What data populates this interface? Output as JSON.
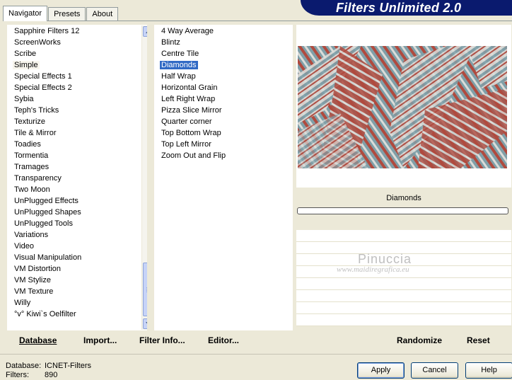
{
  "window": {
    "title": "Filters Unlimited 2.0"
  },
  "tabs": [
    {
      "label": "Navigator",
      "active": true
    },
    {
      "label": "Presets",
      "active": false
    },
    {
      "label": "About",
      "active": false
    }
  ],
  "categories": {
    "selected": "Simple",
    "items": [
      "Sapphire Filters 12",
      "ScreenWorks",
      "Scribe",
      "Simple",
      "Special Effects 1",
      "Special Effects 2",
      "Sybia",
      "Teph's Tricks",
      "Texturize",
      "Tile & Mirror",
      "Toadies",
      "Tormentia",
      "Tramages",
      "Transparency",
      "Two Moon",
      "UnPlugged Effects",
      "UnPlugged Shapes",
      "UnPlugged Tools",
      "Variations",
      "Video",
      "Visual Manipulation",
      "VM Distortion",
      "VM Stylize",
      "VM Texture",
      "Willy",
      "°v° Kiwi`s Oelfilter"
    ]
  },
  "filters": {
    "selected": "Diamonds",
    "items": [
      "4 Way Average",
      "Blintz",
      "Centre Tile",
      "Diamonds",
      "Half Wrap",
      "Horizontal Grain",
      "Left Right Wrap",
      "Pizza Slice Mirror",
      "Quarter corner",
      "Top Bottom Wrap",
      "Top Left Mirror",
      "Zoom Out and Flip"
    ]
  },
  "preview": {
    "filter_name": "Diamonds",
    "progress": 0,
    "colors": {
      "red": "#b04a3e",
      "teal": "#7f9fa8",
      "light": "#dcdcd8"
    }
  },
  "watermark": {
    "name": "Pinuccia",
    "url": "www.maidiregrafica.eu"
  },
  "commands": {
    "database": "Database",
    "import": "Import...",
    "filter_info": "Filter Info...",
    "editor": "Editor...",
    "randomize": "Randomize",
    "reset": "Reset"
  },
  "status": {
    "database_label": "Database:",
    "database_value": "ICNET-Filters",
    "filters_label": "Filters:",
    "filters_value": "890"
  },
  "buttons": {
    "apply": "Apply",
    "cancel": "Cancel",
    "help": "Help"
  }
}
